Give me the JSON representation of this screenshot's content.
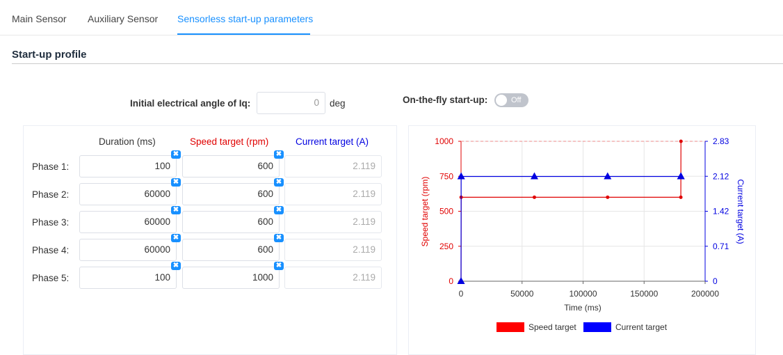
{
  "tabs": [
    {
      "label": "Main Sensor",
      "active": false
    },
    {
      "label": "Auxiliary Sensor",
      "active": false
    },
    {
      "label": "Sensorless start-up parameters",
      "active": true
    }
  ],
  "section_title": "Start-up profile",
  "angle": {
    "label": "Initial electrical angle of Iq:",
    "value": "0",
    "unit": "deg"
  },
  "on_the_fly": {
    "label": "On-the-fly start-up:",
    "state": "Off"
  },
  "table": {
    "headers": {
      "duration": "Duration (ms)",
      "speed": "Speed target (rpm)",
      "current": "Current target (A)"
    },
    "rows": [
      {
        "label": "Phase 1:",
        "duration": "100",
        "speed": "600",
        "current": "2.119"
      },
      {
        "label": "Phase 2:",
        "duration": "60000",
        "speed": "600",
        "current": "2.119"
      },
      {
        "label": "Phase 3:",
        "duration": "60000",
        "speed": "600",
        "current": "2.119"
      },
      {
        "label": "Phase 4:",
        "duration": "60000",
        "speed": "600",
        "current": "2.119"
      },
      {
        "label": "Phase 5:",
        "duration": "100",
        "speed": "1000",
        "current": "2.119"
      }
    ]
  },
  "colors": {
    "accent": "#1890ff",
    "speed": "#e00000",
    "current": "#0000e0"
  },
  "icons": {
    "clear": "clear-icon"
  },
  "chart_data": {
    "type": "line",
    "xlabel": "Time (ms)",
    "ylabel": "Speed target (rpm)",
    "y2label": "Current target (A)",
    "xlim": [
      0,
      200000
    ],
    "ylim": [
      0,
      1000
    ],
    "y2lim": [
      0,
      2.83
    ],
    "x_ticks": [
      "0",
      "50000",
      "100000",
      "150000",
      "200000"
    ],
    "y_ticks": [
      "0",
      "250",
      "500",
      "750",
      "1000"
    ],
    "y2_ticks": [
      "0",
      "0.71",
      "1.42",
      "2.12",
      "2.83"
    ],
    "grid": true,
    "legend": "bottom",
    "series": [
      {
        "name": "Speed target",
        "axis": "left",
        "x": [
          0,
          100,
          60100,
          120100,
          180100,
          180200
        ],
        "y": [
          0,
          600,
          600,
          600,
          600,
          1000
        ]
      },
      {
        "name": "Current target",
        "axis": "right",
        "x": [
          0,
          100,
          60100,
          120100,
          180100,
          180200
        ],
        "y": [
          0,
          2.119,
          2.119,
          2.119,
          2.119,
          2.119
        ]
      }
    ]
  }
}
